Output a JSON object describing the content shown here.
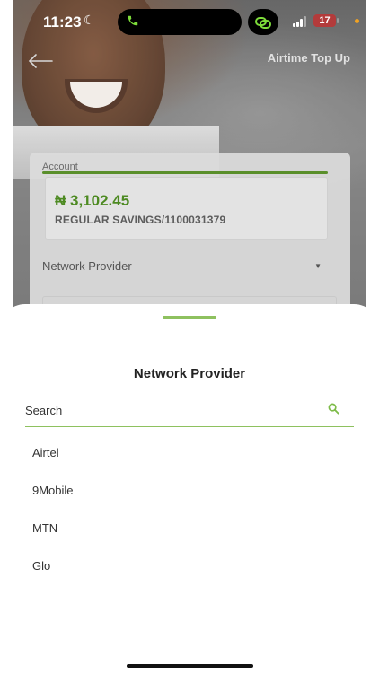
{
  "status_bar": {
    "time": "11:23",
    "battery": "17",
    "moon_icon": "moon-icon",
    "call_icon": "phone-icon",
    "share_icon": "shareplay-icon",
    "colors": {
      "battery": "#b33b3b",
      "call": "#7ddc3a",
      "dot": "#f2a321"
    }
  },
  "header": {
    "title": "Airtime Top Up",
    "back_icon": "arrow-left-icon"
  },
  "form": {
    "account_label": "Account",
    "account_amount": "₦ 3,102.45",
    "account_name": "REGULAR SAVINGS/1100031379",
    "network_provider_label": "Network Provider",
    "caret_icon": "caret-down-icon"
  },
  "sheet": {
    "title": "Network Provider",
    "search_placeholder": "Search",
    "search_icon": "search-icon",
    "providers": [
      "Airtel",
      "9Mobile",
      "MTN",
      "Glo"
    ]
  },
  "theme": {
    "accent": "#8ec15f",
    "amount_green": "#4d8a22"
  }
}
